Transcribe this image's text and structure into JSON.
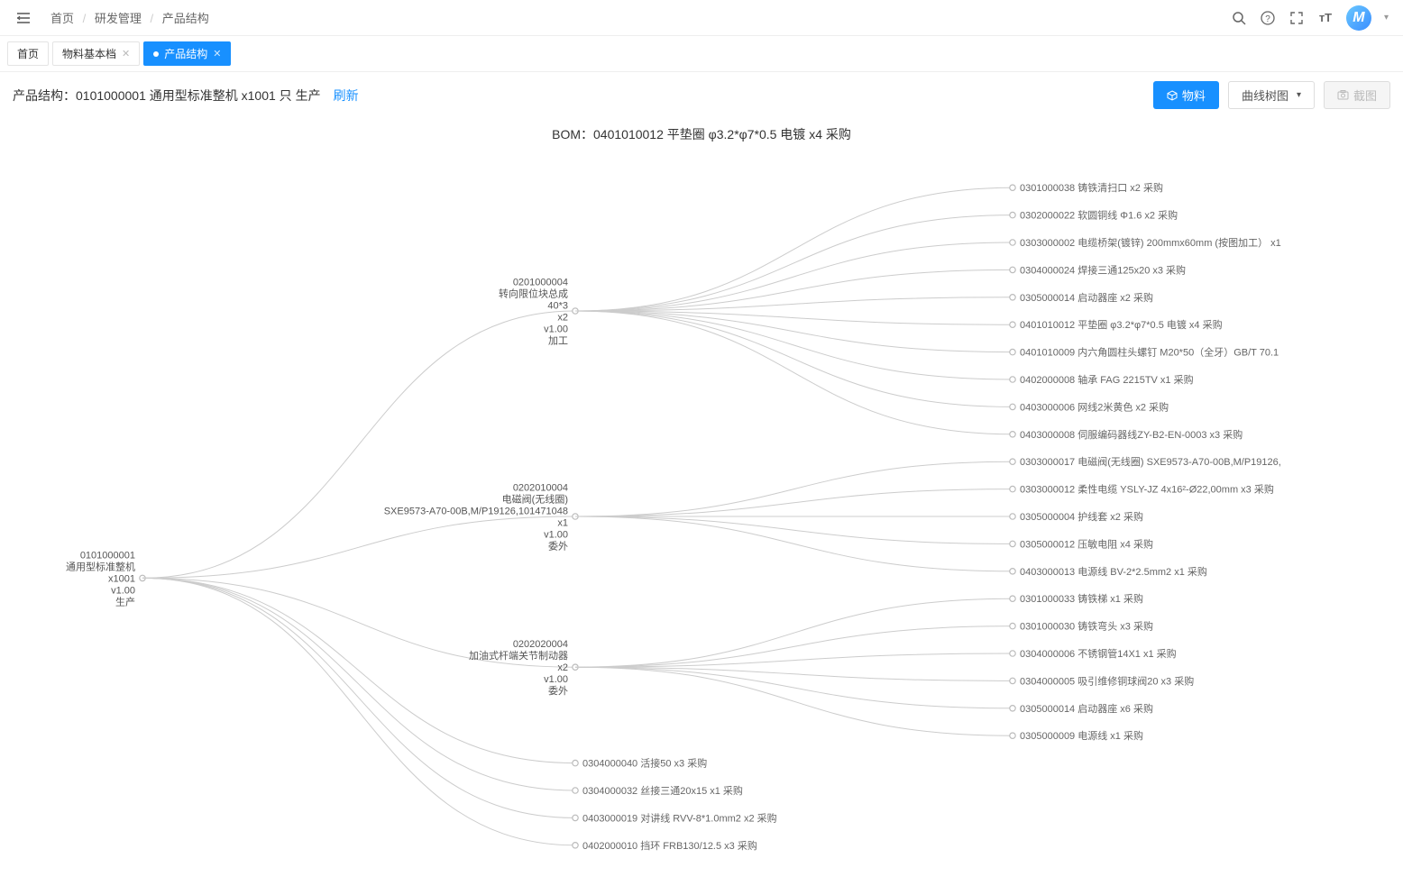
{
  "breadcrumb": {
    "home": "首页",
    "cat": "研发管理",
    "page": "产品结构"
  },
  "tabs": [
    {
      "label": "首页",
      "closable": false
    },
    {
      "label": "物料基本档",
      "closable": true
    },
    {
      "label": "产品结构",
      "closable": true,
      "active": true
    }
  ],
  "header": {
    "title_prefix": "产品结构：",
    "title": "0101000001 通用型标准整机 x1001 只 生产",
    "refresh": "刷新",
    "btn_material": "物料",
    "view_select": "曲线树图",
    "screenshot": "截图"
  },
  "bom_title": "BOM：0401010012 平垫圈 φ3.2*φ7*0.5 电镀 x4 采购",
  "avatar_letter": "M",
  "chart_data": {
    "type": "tree",
    "root": {
      "lines": [
        "0101000001",
        "通用型标准整机",
        "x1001",
        "v1.00",
        "生产"
      ],
      "children": [
        {
          "lines": [
            "0201000004",
            "转向限位块总成",
            "40*3",
            "x2",
            "v1.00",
            "加工"
          ],
          "children": [
            {
              "label": "0301000038 铸铁清扫口  x2 采购"
            },
            {
              "label": "0302000022 软圆铜线 Φ1.6  x2 采购"
            },
            {
              "label": "0303000002 电缆桥架(镀锌) 200mmx60mm (按图加工）  x1"
            },
            {
              "label": "0304000024 焊接三通125x20  x3 采购"
            },
            {
              "label": "0305000014 启动器座  x2 采购"
            },
            {
              "label": "0401010012 平垫圈 φ3.2*φ7*0.5  电镀 x4 采购"
            },
            {
              "label": "0401010009 内六角圆柱头螺钉 M20*50（全牙）GB/T 70.1"
            },
            {
              "label": "0402000008 轴承 FAG 2215TV x1 采购"
            },
            {
              "label": "0403000006 网线2米黄色  x2 采购"
            },
            {
              "label": "0403000008 伺服编码器线ZY-B2-EN-0003  x3 采购"
            }
          ]
        },
        {
          "lines": [
            "0202010004",
            "电磁阀(无线圈)",
            "SXE9573-A70-00B,M/P19126,101471048",
            "x1",
            "v1.00",
            "委外"
          ],
          "children": [
            {
              "label": "0303000017 电磁阀(无线圈) SXE9573-A70-00B,M/P19126,"
            },
            {
              "label": "0303000012 柔性电缆 YSLY-JZ 4x16²-Ø22,00mm x3 采购"
            },
            {
              "label": "0305000004 护线套  x2 采购"
            },
            {
              "label": "0305000012 压敏电阻  x4 采购"
            },
            {
              "label": "0403000013 电源线 BV-2*2.5mm2  x1 采购"
            }
          ]
        },
        {
          "lines": [
            "0202020004",
            "加油式杆端关节制动器",
            "",
            "x2",
            "v1.00",
            "委外"
          ],
          "children": [
            {
              "label": "0301000033 铸铁梯  x1 采购"
            },
            {
              "label": "0301000030 铸铁弯头  x3 采购"
            },
            {
              "label": "0304000006 不锈钢管14X1  x1 采购"
            },
            {
              "label": "0304000005 吸引维修铜球阀20  x3 采购"
            },
            {
              "label": "0305000014 启动器座  x6 采购"
            },
            {
              "label": "0305000009 电源线  x1 采购"
            }
          ]
        },
        {
          "label": "0304000040 活接50  x3 采购"
        },
        {
          "label": "0304000032 丝接三通20x15  x1 采购"
        },
        {
          "label": "0403000019 对讲线 RVV-8*1.0mm2  x2 采购"
        },
        {
          "label": "0402000010 挡环 FRB130/12.5 x3 采购"
        }
      ]
    }
  }
}
